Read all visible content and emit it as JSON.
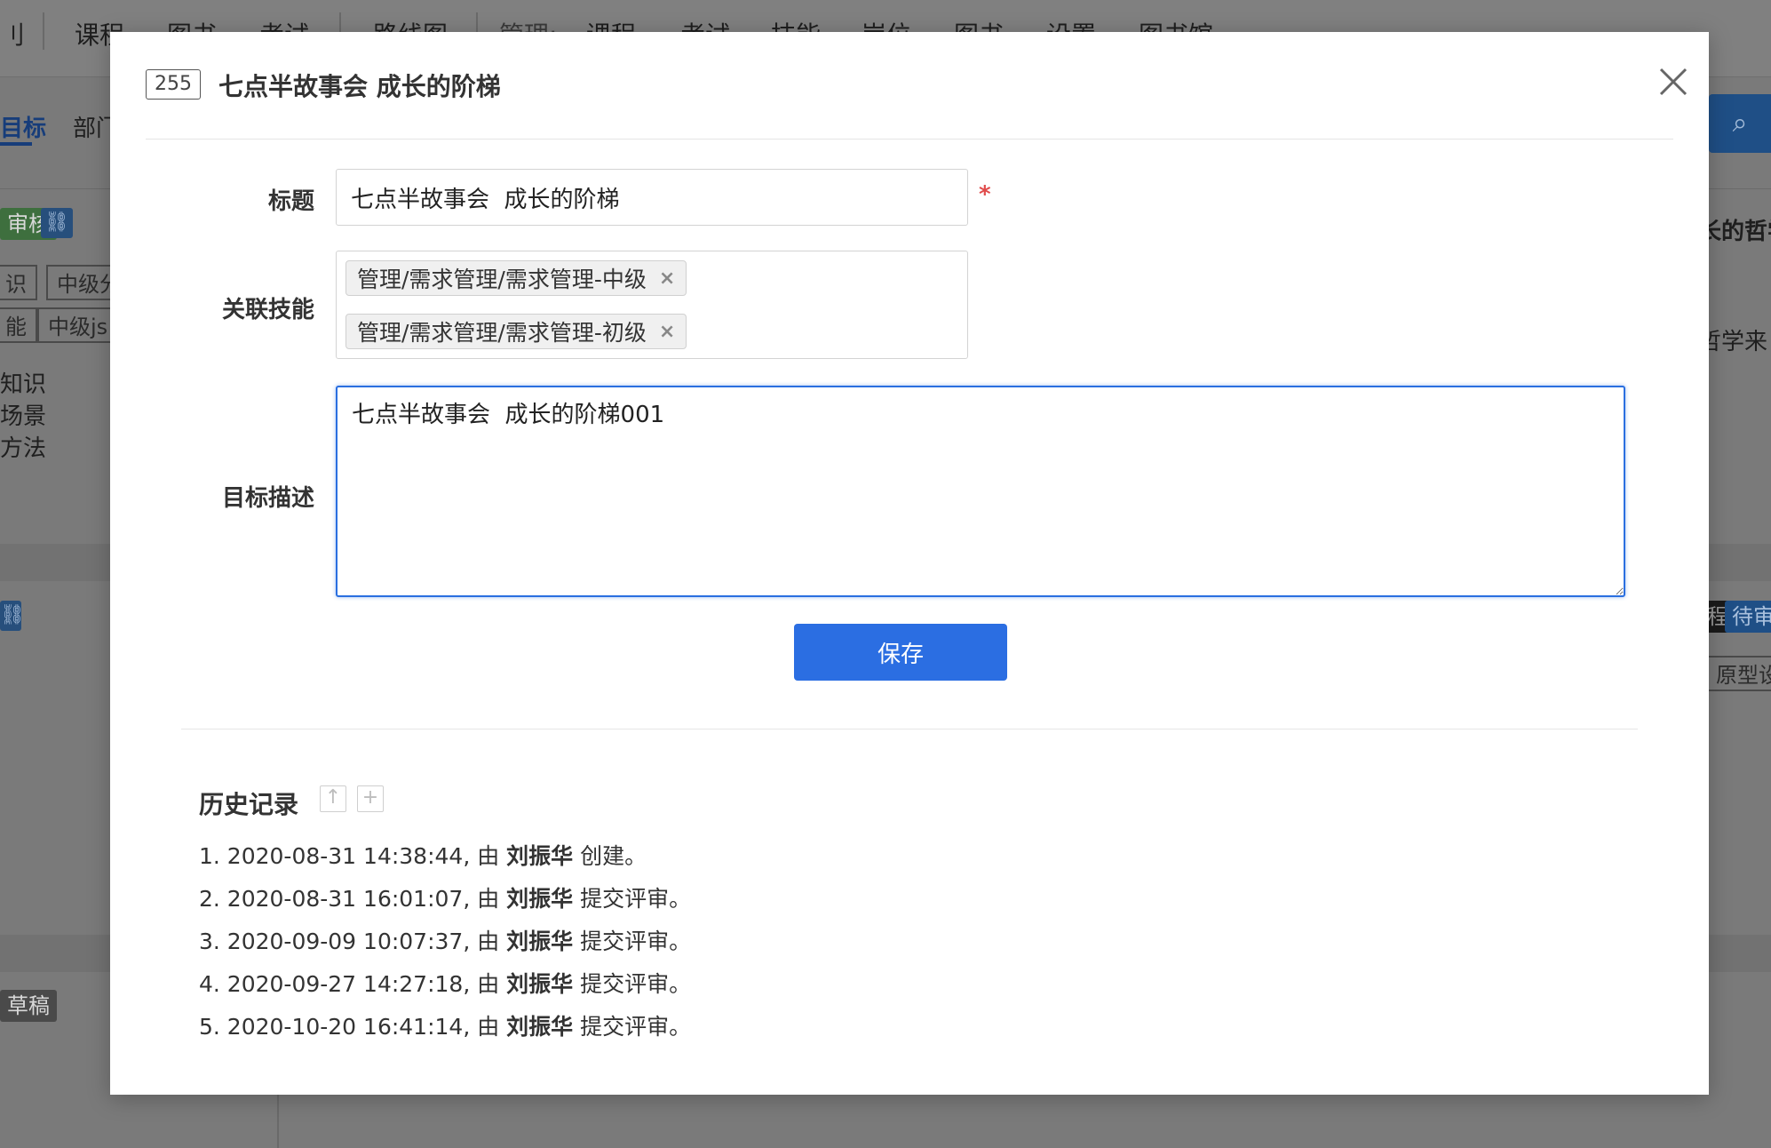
{
  "background": {
    "top_nav": [
      "刂",
      "课程",
      "图书",
      "考试",
      "路线图",
      "管理:",
      "课程",
      "考试",
      "技能",
      "岗位",
      "图书",
      "设置",
      "图书馆"
    ],
    "tabs": [
      "目标",
      "部门"
    ],
    "left_badge_audit": "审核",
    "left_tags": [
      "识",
      "中级分",
      "能",
      "中级js"
    ],
    "left_lines": [
      "知识",
      "场景",
      "方法"
    ],
    "left_badge_draft": "草稿",
    "right_title_fragment": "长的哲学",
    "right_line_fragment": "哲学来",
    "right_badge_pending": "待审",
    "right_badge_dark": "程",
    "right_tag_fragment": "原型设"
  },
  "modal": {
    "id_badge": "255",
    "title": "七点半故事会 成长的阶梯",
    "form": {
      "title_label": "标题",
      "title_value": "七点半故事会  成长的阶梯",
      "required_mark": "*",
      "skills_label": "关联技能",
      "skills": [
        "管理/需求管理/需求管理-中级",
        "管理/需求管理/需求管理-初级"
      ],
      "tag_remove": "×",
      "description_label": "目标描述",
      "description_value": "七点半故事会  成长的阶梯001",
      "save_label": "保存"
    },
    "history": {
      "title": "历史记录",
      "icon_up": "↑",
      "icon_plus": "+",
      "items": [
        {
          "prefix": "1. 2020-08-31 14:38:44, 由 ",
          "user": "刘振华",
          "action": " 创建。"
        },
        {
          "prefix": "2. 2020-08-31 16:01:07, 由 ",
          "user": "刘振华",
          "action": " 提交评审。"
        },
        {
          "prefix": "3. 2020-09-09 10:07:37, 由 ",
          "user": "刘振华",
          "action": " 提交评审。"
        },
        {
          "prefix": "4. 2020-09-27 14:27:18, 由 ",
          "user": "刘振华",
          "action": " 提交评审。"
        },
        {
          "prefix": "5. 2020-10-20 16:41:14, 由 ",
          "user": "刘振华",
          "action": " 提交评审。"
        }
      ]
    }
  },
  "colors": {
    "primary": "#2b6ee2",
    "required": "#e04b4b",
    "overlay": "#7a7a7a"
  }
}
